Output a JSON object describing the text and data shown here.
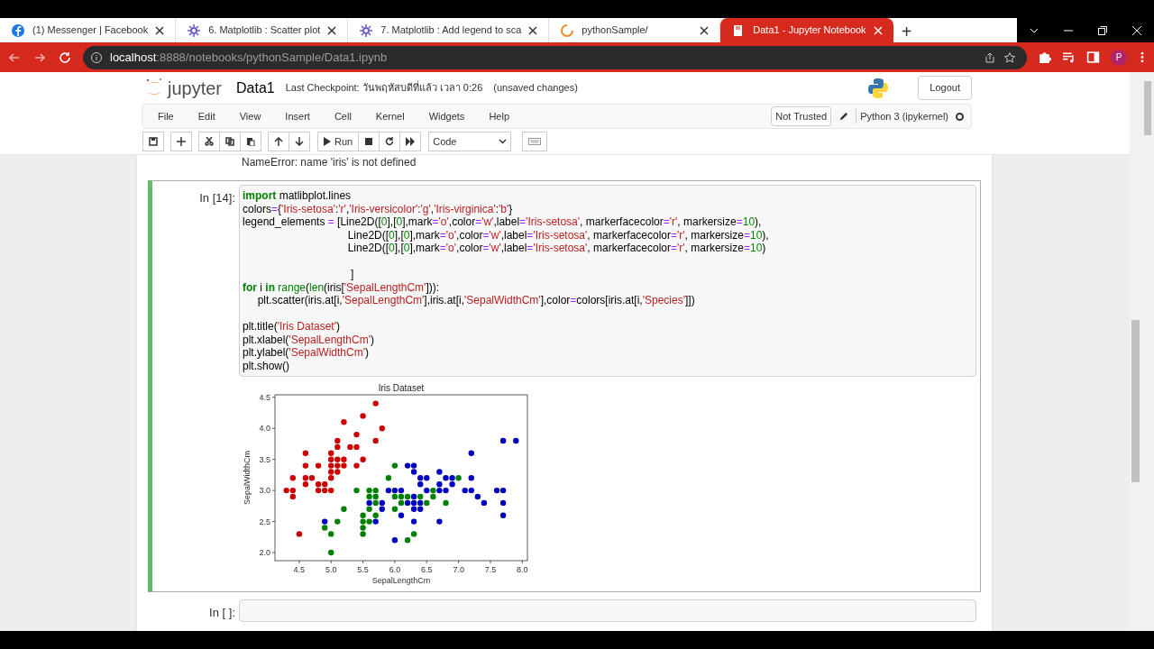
{
  "browser": {
    "tabs": [
      {
        "title": "(1) Messenger | Facebook",
        "kind": "social",
        "selected": false
      },
      {
        "title": "6. Matplotlib : Scatter plot",
        "kind": "plot",
        "selected": false
      },
      {
        "title": "7. Matplotlib : Add legend to sca",
        "kind": "plot",
        "selected": false
      },
      {
        "title": "pythonSample/",
        "kind": "loading",
        "selected": false
      },
      {
        "title": "Data1 - Jupyter Notebook",
        "kind": "notebook",
        "selected": true
      }
    ],
    "new_tab": "+",
    "url_host": "localhost",
    "url_path": ":8888/notebooks/pythonSample/Data1.ipynb",
    "profile": "P"
  },
  "header": {
    "logo": "jupyter",
    "notebook_name": "Data1",
    "checkpoint": "Last Checkpoint: วันพฤหัสบดีที่แล้ว เวลา 0:26",
    "save_status": "(unsaved changes)",
    "logout": "Logout"
  },
  "menubar": {
    "items": [
      "File",
      "Edit",
      "View",
      "Insert",
      "Cell",
      "Kernel",
      "Widgets",
      "Help"
    ],
    "trust": "Not Trusted",
    "kernel": "Python 3 (ipykernel)",
    "kernel_busy": false
  },
  "toolbar": {
    "run": "Run",
    "cell_type": "Code"
  },
  "previous_output": "NameError: name 'iris' is not defined",
  "cells": [
    {
      "prompt": "In [14]:",
      "selected": true,
      "lines": [
        {
          "kind": "code",
          "tokens": [
            {
              "kind": "keyword",
              "text": "import"
            },
            {
              "kind": "plain",
              "text": " matlibplot.lines"
            }
          ]
        },
        {
          "kind": "code",
          "tokens": [
            {
              "kind": "plain",
              "text": "colors"
            },
            {
              "kind": "op",
              "text": "="
            },
            {
              "kind": "plain",
              "text": "{"
            },
            {
              "kind": "string",
              "text": "'Iris-setosa'"
            },
            {
              "kind": "plain",
              "text": ":"
            },
            {
              "kind": "string",
              "text": "'r'"
            },
            {
              "kind": "plain",
              "text": ","
            },
            {
              "kind": "string",
              "text": "'Iris-versicolor'"
            },
            {
              "kind": "plain",
              "text": ":"
            },
            {
              "kind": "string",
              "text": "'g'"
            },
            {
              "kind": "plain",
              "text": ","
            },
            {
              "kind": "string",
              "text": "'Iris-virginica'"
            },
            {
              "kind": "plain",
              "text": ":"
            },
            {
              "kind": "string",
              "text": "'b'"
            },
            {
              "kind": "plain",
              "text": "}"
            }
          ]
        },
        {
          "kind": "code",
          "tokens": [
            {
              "kind": "plain",
              "text": "legend_elements "
            },
            {
              "kind": "op",
              "text": "="
            },
            {
              "kind": "plain",
              "text": " [Line2D(["
            },
            {
              "kind": "number",
              "text": "0"
            },
            {
              "kind": "plain",
              "text": "],["
            },
            {
              "kind": "number",
              "text": "0"
            },
            {
              "kind": "plain",
              "text": "],mark"
            },
            {
              "kind": "op",
              "text": "="
            },
            {
              "kind": "string",
              "text": "'o'"
            },
            {
              "kind": "plain",
              "text": ",color"
            },
            {
              "kind": "op",
              "text": "="
            },
            {
              "kind": "string",
              "text": "'w'"
            },
            {
              "kind": "plain",
              "text": ",label"
            },
            {
              "kind": "op",
              "text": "="
            },
            {
              "kind": "string",
              "text": "'Iris-setosa'"
            },
            {
              "kind": "plain",
              "text": ", markerfacecolor"
            },
            {
              "kind": "op",
              "text": "="
            },
            {
              "kind": "string",
              "text": "'r'"
            },
            {
              "kind": "plain",
              "text": ", markersize"
            },
            {
              "kind": "op",
              "text": "="
            },
            {
              "kind": "number",
              "text": "10"
            },
            {
              "kind": "plain",
              "text": "),"
            }
          ]
        },
        {
          "kind": "code",
          "tokens": [
            {
              "kind": "plain",
              "text": "                                   Line2D(["
            },
            {
              "kind": "number",
              "text": "0"
            },
            {
              "kind": "plain",
              "text": "],["
            },
            {
              "kind": "number",
              "text": "0"
            },
            {
              "kind": "plain",
              "text": "],mark"
            },
            {
              "kind": "op",
              "text": "="
            },
            {
              "kind": "string",
              "text": "'o'"
            },
            {
              "kind": "plain",
              "text": ",color"
            },
            {
              "kind": "op",
              "text": "="
            },
            {
              "kind": "string",
              "text": "'w'"
            },
            {
              "kind": "plain",
              "text": ",label"
            },
            {
              "kind": "op",
              "text": "="
            },
            {
              "kind": "string",
              "text": "'Iris-setosa'"
            },
            {
              "kind": "plain",
              "text": ", markerfacecolor"
            },
            {
              "kind": "op",
              "text": "="
            },
            {
              "kind": "string",
              "text": "'r'"
            },
            {
              "kind": "plain",
              "text": ", markersize"
            },
            {
              "kind": "op",
              "text": "="
            },
            {
              "kind": "number",
              "text": "10"
            },
            {
              "kind": "plain",
              "text": "),"
            }
          ]
        },
        {
          "kind": "code",
          "tokens": [
            {
              "kind": "plain",
              "text": "                                   Line2D(["
            },
            {
              "kind": "number",
              "text": "0"
            },
            {
              "kind": "plain",
              "text": "],["
            },
            {
              "kind": "number",
              "text": "0"
            },
            {
              "kind": "plain",
              "text": "],mark"
            },
            {
              "kind": "op",
              "text": "="
            },
            {
              "kind": "string",
              "text": "'o'"
            },
            {
              "kind": "plain",
              "text": ",color"
            },
            {
              "kind": "op",
              "text": "="
            },
            {
              "kind": "string",
              "text": "'w'"
            },
            {
              "kind": "plain",
              "text": ",label"
            },
            {
              "kind": "op",
              "text": "="
            },
            {
              "kind": "string",
              "text": "'Iris-setosa'"
            },
            {
              "kind": "plain",
              "text": ", markerfacecolor"
            },
            {
              "kind": "op",
              "text": "="
            },
            {
              "kind": "string",
              "text": "'r'"
            },
            {
              "kind": "plain",
              "text": ", markersize"
            },
            {
              "kind": "op",
              "text": "="
            },
            {
              "kind": "number",
              "text": "10"
            },
            {
              "kind": "plain",
              "text": ")"
            }
          ]
        },
        {
          "kind": "blank"
        },
        {
          "kind": "code",
          "tokens": [
            {
              "kind": "plain",
              "text": "                                    ]"
            }
          ]
        },
        {
          "kind": "code",
          "tokens": [
            {
              "kind": "keyword",
              "text": "for"
            },
            {
              "kind": "plain",
              "text": " i "
            },
            {
              "kind": "keyword",
              "text": "in "
            },
            {
              "kind": "builtin",
              "text": "range"
            },
            {
              "kind": "plain",
              "text": "("
            },
            {
              "kind": "builtin",
              "text": "len"
            },
            {
              "kind": "plain",
              "text": "(iris["
            },
            {
              "kind": "string",
              "text": "'SepalLengthCm'"
            },
            {
              "kind": "plain",
              "text": "])):"
            }
          ]
        },
        {
          "kind": "code",
          "tokens": [
            {
              "kind": "plain",
              "text": "     plt.scatter(iris.at[i,"
            },
            {
              "kind": "string",
              "text": "'SepalLengthCm'"
            },
            {
              "kind": "plain",
              "text": "],iris.at[i,"
            },
            {
              "kind": "string",
              "text": "'SepalWidthCm'"
            },
            {
              "kind": "plain",
              "text": "],color"
            },
            {
              "kind": "op",
              "text": "="
            },
            {
              "kind": "plain",
              "text": "colors[iris.at[i,"
            },
            {
              "kind": "string",
              "text": "'Species'"
            },
            {
              "kind": "plain",
              "text": "]])"
            }
          ]
        },
        {
          "kind": "blank"
        },
        {
          "kind": "code",
          "tokens": [
            {
              "kind": "plain",
              "text": "plt.title("
            },
            {
              "kind": "string",
              "text": "'Iris Dataset'"
            },
            {
              "kind": "plain",
              "text": ")"
            }
          ]
        },
        {
          "kind": "code",
          "tokens": [
            {
              "kind": "plain",
              "text": "plt.xlabel("
            },
            {
              "kind": "string",
              "text": "'SepalLengthCm'"
            },
            {
              "kind": "plain",
              "text": ")"
            }
          ]
        },
        {
          "kind": "code",
          "tokens": [
            {
              "kind": "plain",
              "text": "plt.ylabel("
            },
            {
              "kind": "string",
              "text": "'SepalWidthCm'"
            },
            {
              "kind": "plain",
              "text": ")"
            }
          ]
        },
        {
          "kind": "code",
          "tokens": [
            {
              "kind": "plain",
              "text": "plt.show()"
            }
          ]
        }
      ],
      "output": {
        "chart_data": {
          "type": "scatter",
          "title": "Iris Dataset",
          "xlabel": "SepalLengthCm",
          "ylabel": "SepalWidthCm",
          "xlim": [
            4.12,
            8.08
          ],
          "ylim": [
            1.87,
            4.54
          ],
          "xticks": [
            {
              "value": 4.5,
              "label": "4.5"
            },
            {
              "value": 5.0,
              "label": "5.0"
            },
            {
              "value": 5.5,
              "label": "5.5"
            },
            {
              "value": 6.0,
              "label": "6.0"
            },
            {
              "value": 6.5,
              "label": "6.5"
            },
            {
              "value": 7.0,
              "label": "7.0"
            },
            {
              "value": 7.5,
              "label": "7.5"
            },
            {
              "value": 8.0,
              "label": "8.0"
            }
          ],
          "yticks": [
            {
              "value": 2.0,
              "label": "2.0"
            },
            {
              "value": 2.5,
              "label": "2.5"
            },
            {
              "value": 3.0,
              "label": "3.0"
            },
            {
              "value": 3.5,
              "label": "3.5"
            },
            {
              "value": 4.0,
              "label": "4.0"
            },
            {
              "value": 4.5,
              "label": "4.5"
            }
          ],
          "series": [
            {
              "color": "#cc0000",
              "x": [
                4.3,
                4.4,
                4.4,
                4.4,
                4.5,
                4.6,
                4.6,
                4.6,
                4.6,
                4.7,
                4.8,
                4.8,
                4.8,
                4.9,
                4.9,
                5.0,
                5.0,
                5.0,
                5.0,
                5.0,
                5.0,
                5.1,
                5.1,
                5.1,
                5.1,
                5.1,
                5.2,
                5.2,
                5.2,
                5.3,
                5.4,
                5.4,
                5.4,
                5.5,
                5.5,
                5.7,
                5.7,
                5.8
              ],
              "values": [
                3.0,
                3.2,
                3.0,
                2.9,
                2.3,
                3.6,
                3.4,
                3.2,
                3.1,
                3.2,
                3.4,
                3.1,
                3.0,
                3.1,
                3.0,
                3.6,
                3.5,
                3.4,
                3.3,
                3.2,
                3.0,
                3.8,
                3.7,
                3.5,
                3.4,
                3.3,
                4.1,
                3.5,
                3.4,
                3.7,
                3.9,
                3.7,
                3.4,
                4.2,
                3.5,
                4.4,
                3.8,
                4.0
              ]
            },
            {
              "color": "#008000",
              "x": [
                4.9,
                5.0,
                5.0,
                5.1,
                5.2,
                5.4,
                5.5,
                5.5,
                5.5,
                5.5,
                5.6,
                5.6,
                5.6,
                5.6,
                5.7,
                5.7,
                5.7,
                5.7,
                5.9,
                6.0,
                6.0,
                6.0,
                6.1,
                6.1,
                6.2,
                6.2,
                6.3,
                6.4,
                6.5,
                6.6,
                6.6,
                6.8,
                7.0
              ],
              "values": [
                2.4,
                2.3,
                2.0,
                2.5,
                2.7,
                3.0,
                2.6,
                2.5,
                2.4,
                2.3,
                3.0,
                2.9,
                2.7,
                2.5,
                3.0,
                2.9,
                2.8,
                2.6,
                3.2,
                3.4,
                2.9,
                2.7,
                2.9,
                2.8,
                2.9,
                2.2,
                2.3,
                2.9,
                2.8,
                3.0,
                2.9,
                2.8,
                3.2
              ]
            },
            {
              "color": "#0000bf",
              "x": [
                4.9,
                5.6,
                5.7,
                5.8,
                5.8,
                5.9,
                6.0,
                6.0,
                6.1,
                6.1,
                6.2,
                6.2,
                6.3,
                6.3,
                6.3,
                6.3,
                6.3,
                6.3,
                6.4,
                6.4,
                6.4,
                6.4,
                6.5,
                6.5,
                6.7,
                6.7,
                6.7,
                6.7,
                6.8,
                6.8,
                6.9,
                6.9,
                7.1,
                7.2,
                7.2,
                7.2,
                7.3,
                7.4,
                7.6,
                7.7,
                7.7,
                7.7,
                7.7,
                7.9
              ],
              "values": [
                2.5,
                2.8,
                2.5,
                2.8,
                2.7,
                3.0,
                3.0,
                2.2,
                3.0,
                2.6,
                3.4,
                2.8,
                3.4,
                3.3,
                2.9,
                2.8,
                2.7,
                2.5,
                3.2,
                3.1,
                2.8,
                2.7,
                3.2,
                3.0,
                3.3,
                3.1,
                3.0,
                2.5,
                3.2,
                3.0,
                3.2,
                3.1,
                3.0,
                3.6,
                3.2,
                3.0,
                2.9,
                2.8,
                3.0,
                3.8,
                3.0,
                2.8,
                2.6,
                3.8
              ]
            }
          ]
        }
      }
    },
    {
      "prompt": "In [ ]:",
      "selected": false
    }
  ]
}
